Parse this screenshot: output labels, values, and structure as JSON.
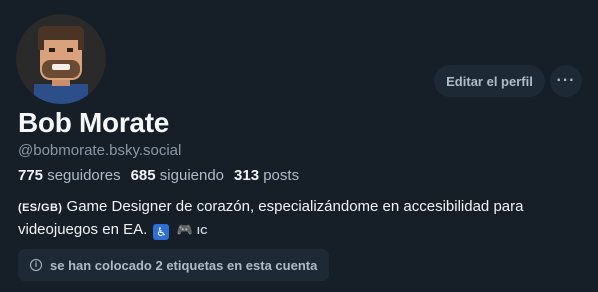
{
  "profile": {
    "display_name": "Bob Morate",
    "handle": "@bobmorate.bsky.social",
    "avatar_icon": "pixel-art-avatar"
  },
  "actions": {
    "edit_profile_label": "Editar el perfil",
    "more_label": "···"
  },
  "stats": {
    "followers_count": "775",
    "followers_label": "seguidores",
    "following_count": "685",
    "following_label": "siguiendo",
    "posts_count": "313",
    "posts_label": "posts"
  },
  "bio": {
    "lang_tag": "(ES/GB)",
    "text_line": "Game Designer de corazón, especializándome en accesibilidad para",
    "text_line2": "videojuegos en EA.",
    "accessibility_emoji": "♿",
    "gamepad_emoji": "🎮",
    "ic_tag": "IC"
  },
  "labels_note": {
    "icon": "info-icon",
    "text": "se han colocado 2 etiquetas en esta cuenta"
  },
  "colors": {
    "background": "#161e27",
    "button_bg": "#1e2936",
    "muted_text": "#aebbc9",
    "primary_text": "#f1f3f5"
  }
}
